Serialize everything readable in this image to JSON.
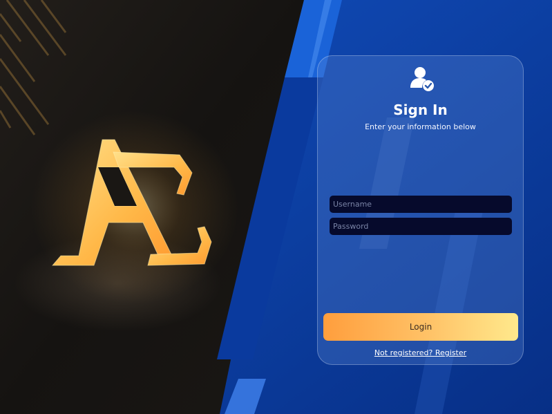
{
  "login": {
    "title": "Sign In",
    "subtitle": "Enter your information below",
    "username_placeholder": "Username",
    "password_placeholder": "Password",
    "login_label": "Login",
    "register_link": "Not registered? Register"
  },
  "branding": {
    "logo_text": "AC"
  },
  "icons": {
    "user": "user-check-icon"
  },
  "colors": {
    "background_dark": "#141210",
    "background_blue": "#0a3fa8",
    "accent_gold": "#ffb648",
    "input_bg": "#060a2c"
  }
}
